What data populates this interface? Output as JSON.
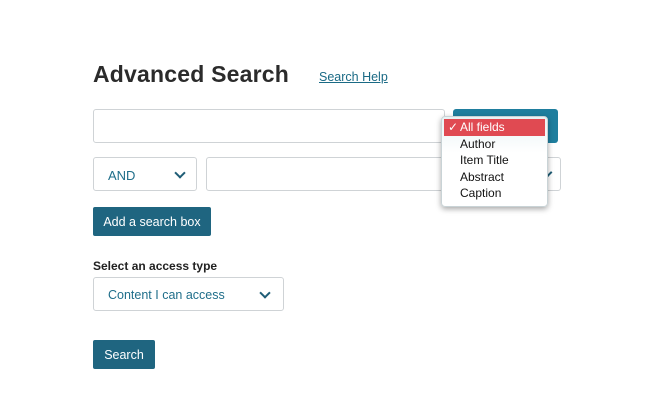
{
  "header": {
    "title": "Advanced Search",
    "help_link": "Search Help"
  },
  "search_row_1": {
    "value": "",
    "field_select": {
      "options": [
        "All fields",
        "Author",
        "Item Title",
        "Abstract",
        "Caption"
      ],
      "selected": "All fields",
      "check_mark": "✓"
    }
  },
  "search_row_2": {
    "operator": "AND",
    "value": ""
  },
  "add_box_button": "Add a search box",
  "access": {
    "label": "Select an access type",
    "selected": "Content I can access"
  },
  "search_button": "Search",
  "colors": {
    "primary_button": "#1f6580",
    "link": "#1a6a85",
    "selected_option": "#e04a52"
  },
  "icons": {
    "select_arrow": "chevron-down-icon",
    "check": "check-icon"
  }
}
